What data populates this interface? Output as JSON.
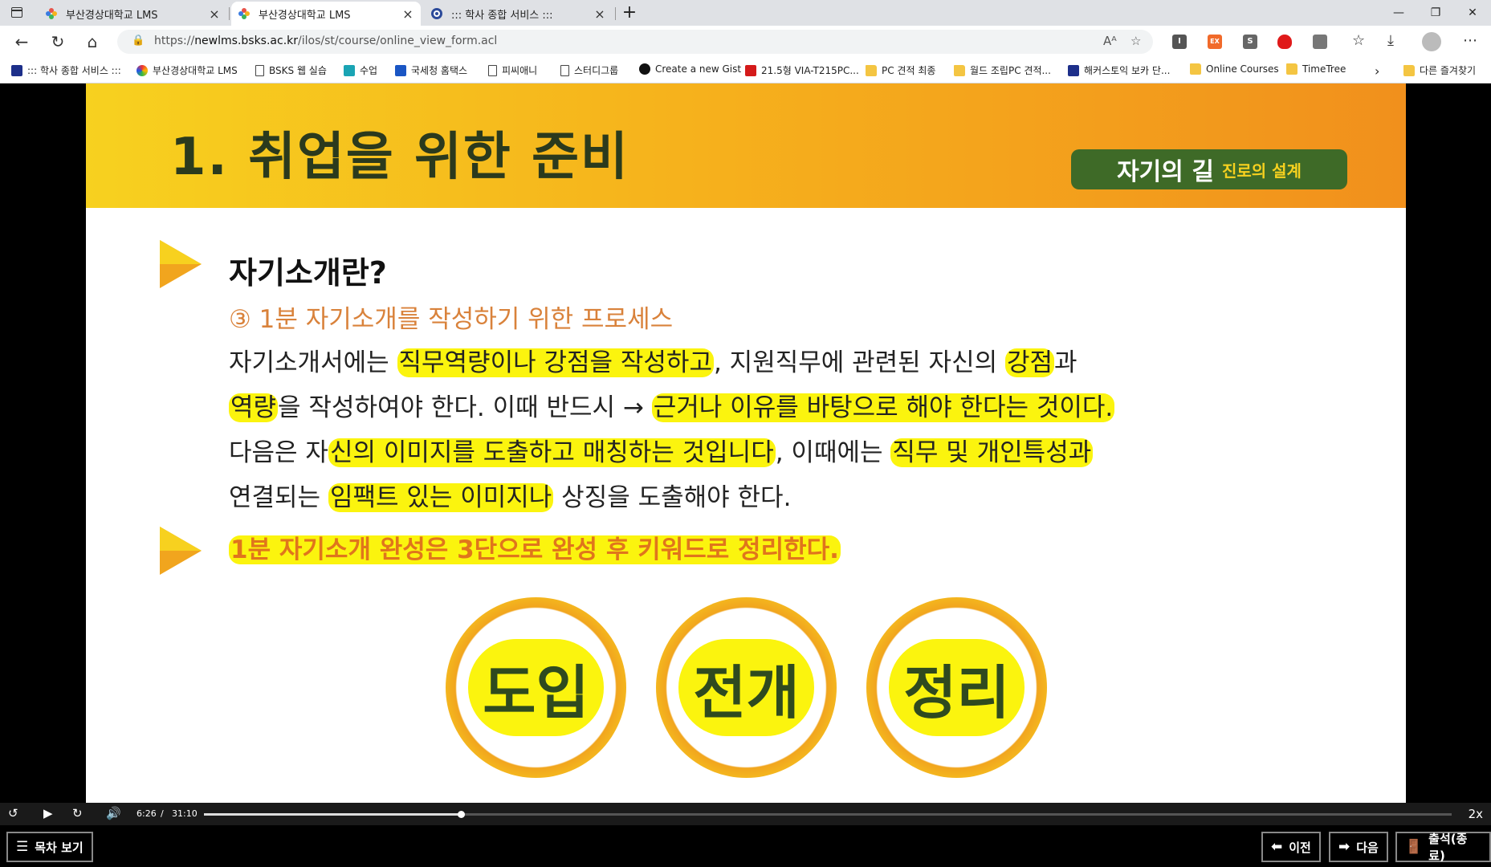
{
  "browser": {
    "tabs": [
      {
        "title": "부산경상대학교 LMS",
        "active": false,
        "icon": "lms-pinwheel-icon"
      },
      {
        "title": "부산경상대학교 LMS",
        "active": true,
        "icon": "lms-pinwheel-icon"
      },
      {
        "title": "::: 학사 종합 서비스 :::",
        "active": false,
        "icon": "school-emblem-icon"
      }
    ],
    "url_prefix": "https://",
    "url_host": "newlms.bsks.ac.kr",
    "url_path": "/ilos/st/course/online_view_form.acl",
    "bookmarks": [
      "::: 학사 종합 서비스 :::",
      "부산경상대학교 LMS",
      "BSKS 웹 실습",
      "수업",
      "국세청 홈택스",
      "피씨애니",
      "스터디그룹",
      "Create a new Gist",
      "21.5형 VIA-T215PC...",
      "PC 견적 최종",
      "월드 조립PC 견적...",
      "해커스토익 보카 단...",
      "Online Courses",
      "TimeTree"
    ],
    "bookmarks_other": "다른 즐겨찾기",
    "extensions": [
      "I",
      "EX",
      "S"
    ]
  },
  "slide": {
    "title": "1. 취업을 위한 준비",
    "brand_main": "자기의 길",
    "brand_sub": "진로의 설계",
    "subheading": "자기소개란?",
    "step": "③ 1분 자기소개를 작성하기 위한 프로세스",
    "lines": [
      [
        "자기소개서에는 ",
        "직무역량이나 강점을 작성하고",
        ", 지원직무에 관련된 자신의 ",
        "강점",
        "과"
      ],
      [
        "역량",
        "을 작성하여야 한다. 이때 반드시 → ",
        "근거나 이유를 바탕으로 해야 한다는 것이다."
      ],
      [
        "다음은 자",
        "신의 이미지를 도출하고 매칭하는 것입니다",
        ", 이때에는 ",
        "직무 및 개인특성과"
      ],
      [
        "연결되는 ",
        "임팩트 있는 이미지나",
        " 상징을 도출해야 한다."
      ]
    ],
    "summary": "1분 자기소개 완성은 3단으로 완성 후 키워드로 정리한다.",
    "stages": [
      "도입",
      "전개",
      "정리"
    ],
    "colors": {
      "header_start": "#f7d11f",
      "header_end": "#f1901c",
      "brand": "#3e6a27",
      "highlight": "#fbf40e",
      "summary_text": "#e0751c"
    }
  },
  "player": {
    "current_time": "6:26",
    "separator": "/",
    "duration": "31:10",
    "progress": 0.206,
    "speed": "2x"
  },
  "footer": {
    "toc_label": "목차 보기",
    "prev_label": "이전",
    "next_label": "다음",
    "attend_label": "출석(종료)"
  }
}
